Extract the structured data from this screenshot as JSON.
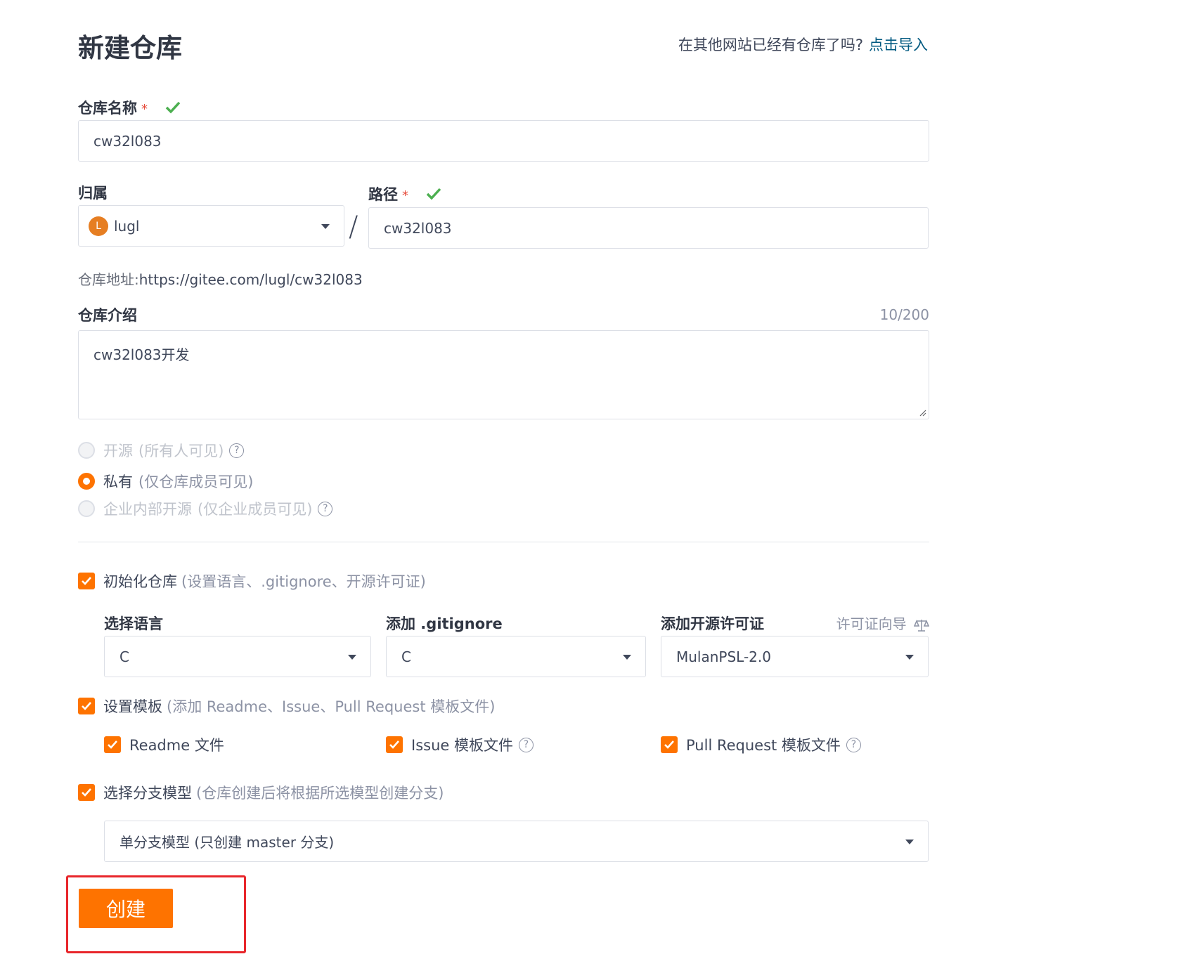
{
  "header": {
    "title": "新建仓库",
    "import_prompt": "在其他网站已经有仓库了吗?",
    "import_link": "点击导入"
  },
  "form": {
    "repo_name_label": "仓库名称",
    "repo_name_value": "cw32l083",
    "required_mark": "*",
    "owner_label": "归属",
    "owner_avatar_letter": "L",
    "owner_value": "lugl",
    "path_separator": "/",
    "path_label": "路径",
    "path_value": "cw32l083",
    "address_label": "仓库地址:",
    "address_url": "https://gitee.com/lugl/cw32l083",
    "desc_label": "仓库介绍",
    "desc_counter": "10/200",
    "desc_value": "cw32l083开发"
  },
  "visibility": [
    {
      "label": "开源",
      "note": "(所有人可见)",
      "selected": false,
      "disabled": true
    },
    {
      "label": "私有",
      "note": "(仅仓库成员可见)",
      "selected": true,
      "disabled": false
    },
    {
      "label": "企业内部开源",
      "note": "(仅企业成员可见)",
      "selected": false,
      "disabled": true
    }
  ],
  "init": {
    "label": "初始化仓库",
    "note": "(设置语言、.gitignore、开源许可证)",
    "language_label": "选择语言",
    "language_value": "C",
    "gitignore_label": "添加 .gitignore",
    "gitignore_value": "C",
    "license_label": "添加开源许可证",
    "license_guide": "许可证向导",
    "license_value": "MulanPSL-2.0"
  },
  "template": {
    "label": "设置模板",
    "note": "(添加 Readme、Issue、Pull Request 模板文件)",
    "readme": "Readme 文件",
    "issue": "Issue 模板文件",
    "pr": "Pull Request 模板文件"
  },
  "branch": {
    "label": "选择分支模型",
    "note": "(仓库创建后将根据所选模型创建分支)",
    "value": "单分支模型 (只创建 master 分支)"
  },
  "actions": {
    "create": "创建"
  },
  "colors": {
    "accent": "#fe7300",
    "link": "#005980",
    "valid": "#4caf50",
    "highlight": "#e8262b"
  }
}
